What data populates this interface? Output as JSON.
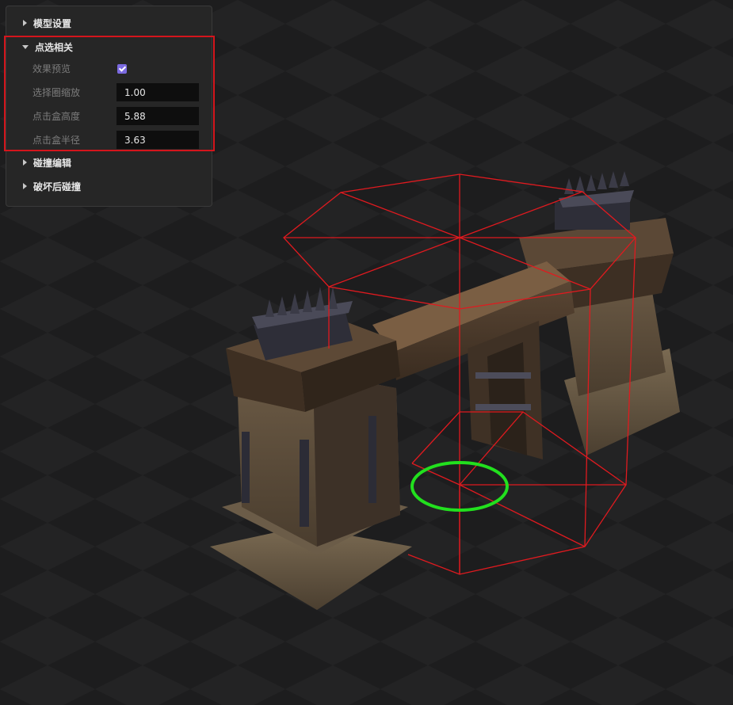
{
  "panel": {
    "sections": [
      {
        "label": "模型设置",
        "expanded": false
      },
      {
        "label": "点选相关",
        "expanded": true
      },
      {
        "label": "碰撞编辑",
        "expanded": false
      },
      {
        "label": "破坏后碰撞",
        "expanded": false
      }
    ],
    "pick": {
      "preview_label": "效果预览",
      "preview_checked": true,
      "scale_label": "选择圈缩放",
      "scale_value": "1.00",
      "height_label": "点击盒高度",
      "height_value": "5.88",
      "radius_label": "点击盒半径",
      "radius_value": "3.63"
    }
  },
  "colors": {
    "checkbox_accent": "#7b6ae0",
    "highlight": "#d4151c",
    "hitbox_wire": "#e01a1f",
    "selection_ring": "#22e01e",
    "panel_bg": "#262626"
  },
  "viewport": {
    "model": "stone-gate-bridge"
  }
}
